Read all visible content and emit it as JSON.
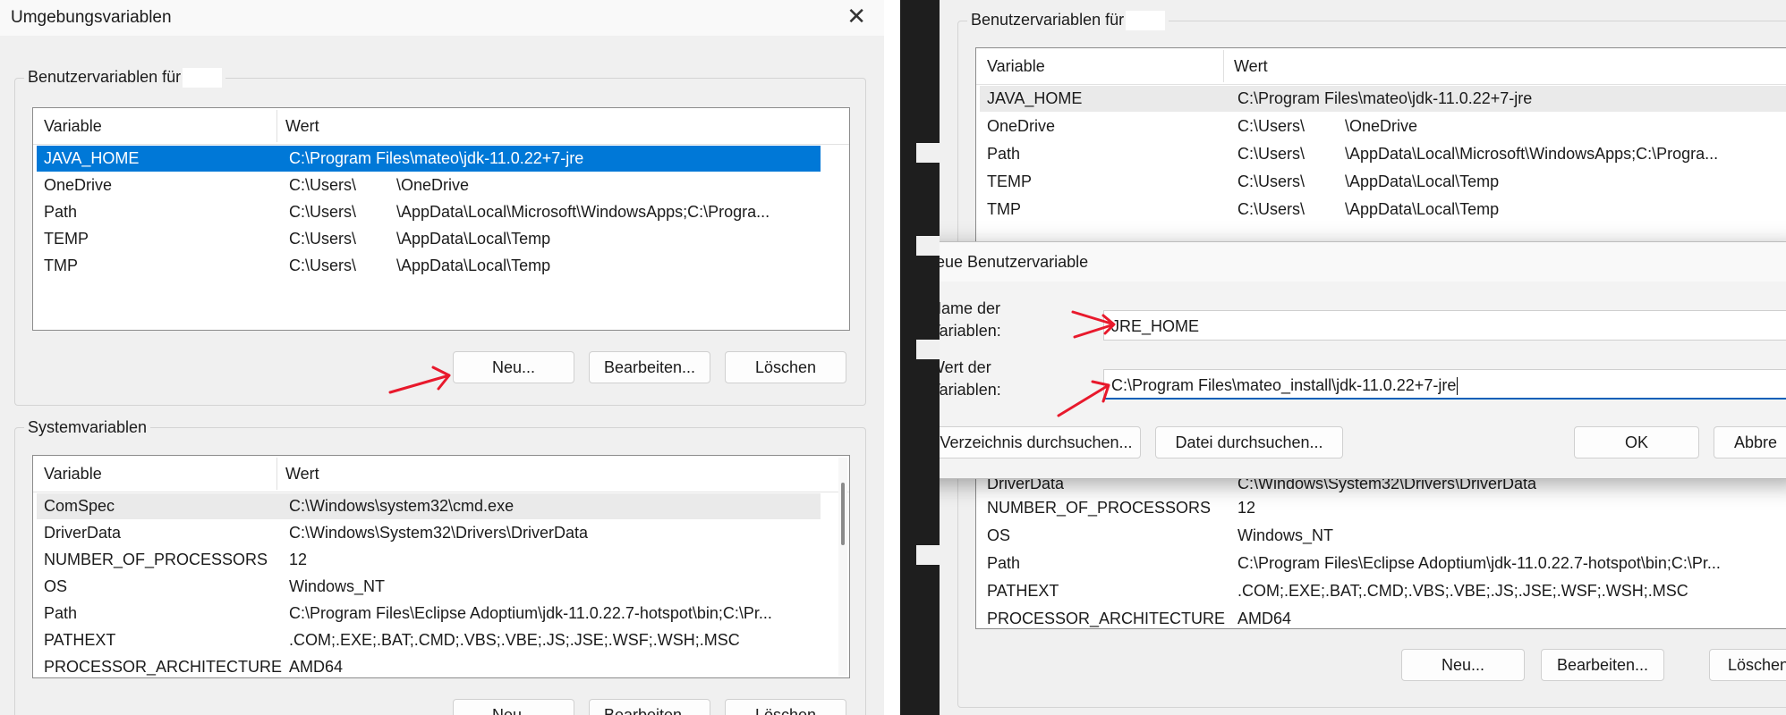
{
  "left": {
    "window_title": "Umgebungsvariablen",
    "close_glyph": "✕",
    "user_group_label": "Benutzervariablen für",
    "system_group_label": "Systemvariablen",
    "columns": [
      "Variable",
      "Wert"
    ],
    "user_rows": [
      {
        "name": "JAVA_HOME",
        "value": "C:\\Program Files\\mateo\\jdk-11.0.22+7-jre",
        "selected": true
      },
      {
        "name": "OneDrive",
        "value_prefix": "C:\\Users\\",
        "value_suffix": "\\OneDrive"
      },
      {
        "name": "Path",
        "value_prefix": "C:\\Users\\",
        "value_suffix": "\\AppData\\Local\\Microsoft\\WindowsApps;C:\\Progra..."
      },
      {
        "name": "TEMP",
        "value_prefix": "C:\\Users\\",
        "value_suffix": "\\AppData\\Local\\Temp"
      },
      {
        "name": "TMP",
        "value_prefix": "C:\\Users\\",
        "value_suffix": "\\AppData\\Local\\Temp"
      }
    ],
    "user_buttons": {
      "new": "Neu...",
      "edit": "Bearbeiten...",
      "delete": "Löschen"
    },
    "system_rows": [
      {
        "name": "ComSpec",
        "value": "C:\\Windows\\system32\\cmd.exe",
        "highlight": true
      },
      {
        "name": "DriverData",
        "value": "C:\\Windows\\System32\\Drivers\\DriverData"
      },
      {
        "name": "NUMBER_OF_PROCESSORS",
        "value": "12"
      },
      {
        "name": "OS",
        "value": "Windows_NT"
      },
      {
        "name": "Path",
        "value": "C:\\Program Files\\Eclipse Adoptium\\jdk-11.0.22.7-hotspot\\bin;C:\\Pr..."
      },
      {
        "name": "PATHEXT",
        "value": ".COM;.EXE;.BAT;.CMD;.VBS;.VBE;.JS;.JSE;.WSF;.WSH;.MSC"
      },
      {
        "name": "PROCESSOR_ARCHITECTURE",
        "value": "AMD64"
      }
    ],
    "system_buttons": {
      "new": "Neu...",
      "edit": "Bearbeiten...",
      "delete": "Löschen"
    }
  },
  "right": {
    "user_group_label": "Benutzervariablen für",
    "columns": [
      "Variable",
      "Wert"
    ],
    "user_rows": [
      {
        "name": "JAVA_HOME",
        "value": "C:\\Program Files\\mateo\\jdk-11.0.22+7-jre",
        "highlight": true
      },
      {
        "name": "OneDrive",
        "value_prefix": "C:\\Users\\",
        "value_suffix": "\\OneDrive"
      },
      {
        "name": "Path",
        "value_prefix": "C:\\Users\\",
        "value_suffix": "\\AppData\\Local\\Microsoft\\WindowsApps;C:\\Progra..."
      },
      {
        "name": "TEMP",
        "value_prefix": "C:\\Users\\",
        "value_suffix": "\\AppData\\Local\\Temp"
      },
      {
        "name": "TMP",
        "value_prefix": "C:\\Users\\",
        "value_suffix": "\\AppData\\Local\\Temp"
      }
    ],
    "system_rows": [
      {
        "name": "DriverData",
        "value": "C:\\Windows\\System32\\Drivers\\DriverData"
      },
      {
        "name": "NUMBER_OF_PROCESSORS",
        "value": "12"
      },
      {
        "name": "OS",
        "value": "Windows_NT"
      },
      {
        "name": "Path",
        "value": "C:\\Program Files\\Eclipse Adoptium\\jdk-11.0.22.7-hotspot\\bin;C:\\Pr..."
      },
      {
        "name": "PATHEXT",
        "value": ".COM;.EXE;.BAT;.CMD;.VBS;.VBE;.JS;.JSE;.WSF;.WSH;.MSC"
      },
      {
        "name": "PROCESSOR_ARCHITECTURE",
        "value": "AMD64"
      }
    ],
    "system_buttons": {
      "new": "Neu...",
      "edit": "Bearbeiten...",
      "delete": "Löschen"
    },
    "dialog": {
      "title": "Neue Benutzervariable",
      "name_label_line1": "Name der",
      "name_label_line2": "Variablen:",
      "name_value": "JRE_HOME",
      "value_label_line1": "Wert der",
      "value_label_line2": "Variablen:",
      "value_value": "C:\\Program Files\\mateo_install\\jdk-11.0.22+7-jre",
      "browse_dir": "Verzeichnis durchsuchen...",
      "browse_file": "Datei durchsuchen...",
      "ok": "OK",
      "cancel": "Abbre"
    }
  },
  "colors": {
    "selection": "#0078d7",
    "annotation_arrow": "#e8192c",
    "divider": "#1e1e1e"
  }
}
